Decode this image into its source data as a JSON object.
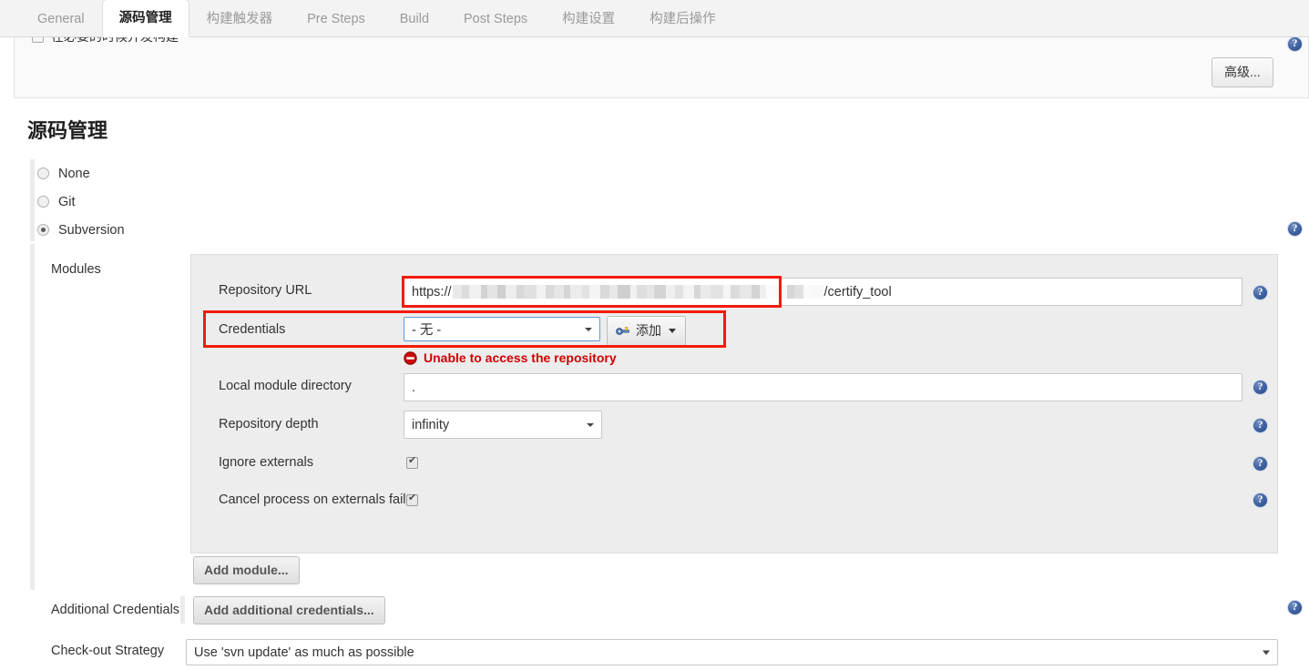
{
  "tabs": [
    {
      "label": "General",
      "active": false
    },
    {
      "label": "源码管理",
      "active": true
    },
    {
      "label": "构建触发器",
      "active": false
    },
    {
      "label": "Pre Steps",
      "active": false
    },
    {
      "label": "Build",
      "active": false
    },
    {
      "label": "Post Steps",
      "active": false
    },
    {
      "label": "构建设置",
      "active": false
    },
    {
      "label": "构建后操作",
      "active": false
    }
  ],
  "top": {
    "concurrent_build_label": "在必要的时候并发构建",
    "advanced_button": "高级..."
  },
  "scm": {
    "heading": "源码管理",
    "options": [
      {
        "label": "None",
        "selected": false
      },
      {
        "label": "Git",
        "selected": false
      },
      {
        "label": "Subversion",
        "selected": true
      }
    ]
  },
  "modules": {
    "section_label": "Modules",
    "repository_url": {
      "label": "Repository URL",
      "value_prefix": "https://",
      "value_suffix": "/certify_tool",
      "redacted": true
    },
    "credentials": {
      "label": "Credentials",
      "selected": "- 无 -",
      "add_button": "添加",
      "add_icon": "key-icon",
      "caret_icon": "chevron-down-icon"
    },
    "error": {
      "icon": "error-deny-icon",
      "message": "Unable to access the repository"
    },
    "local_module_directory": {
      "label": "Local module directory",
      "value": "."
    },
    "repository_depth": {
      "label": "Repository depth",
      "value": "infinity"
    },
    "ignore_externals": {
      "label": "Ignore externals",
      "checked": true
    },
    "cancel_process_on_externals_fail": {
      "label": "Cancel process on externals fail",
      "checked": true
    },
    "add_module_button": "Add module..."
  },
  "additional_credentials": {
    "label": "Additional Credentials",
    "button": "Add additional credentials..."
  },
  "checkout_strategy": {
    "label": "Check-out Strategy",
    "value": "Use 'svn update' as much as possible"
  },
  "help_icon": "help-icon",
  "colors": {
    "accent_blue": "#3d5f9e",
    "error_red": "#d00000",
    "annotation_red": "#f41b08",
    "panel_gray": "#ededed",
    "focus_blue": "#5b9dd9"
  }
}
